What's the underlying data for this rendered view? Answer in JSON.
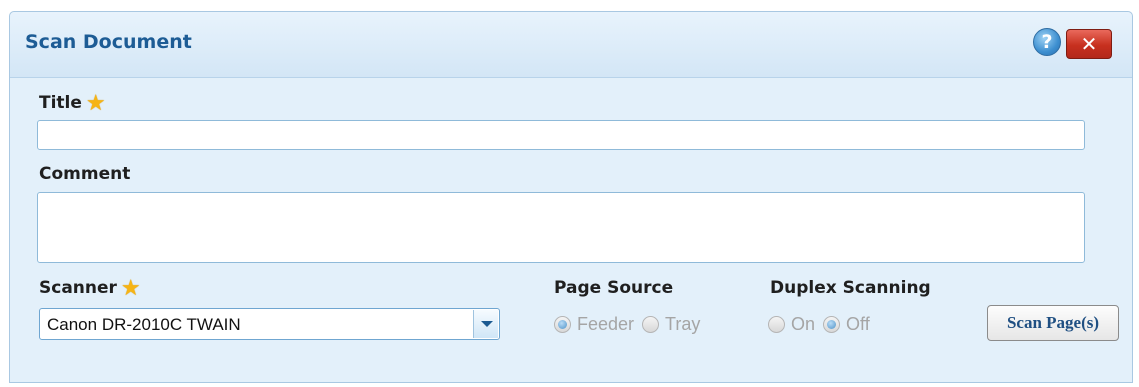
{
  "dialog": {
    "title": "Scan Document",
    "help_label": "?",
    "close_label": "✕"
  },
  "form": {
    "title_label": "Title",
    "title_value": "",
    "comment_label": "Comment",
    "comment_value": "",
    "scanner_label": "Scanner",
    "scanner_selected": "Canon DR-2010C TWAIN",
    "required_star": "★"
  },
  "page_source": {
    "label": "Page Source",
    "options": [
      {
        "label": "Feeder",
        "checked": true
      },
      {
        "label": "Tray",
        "checked": false
      }
    ]
  },
  "duplex": {
    "label": "Duplex Scanning",
    "options": [
      {
        "label": "On",
        "checked": false
      },
      {
        "label": "Off",
        "checked": true
      }
    ]
  },
  "actions": {
    "scan_label": "Scan Page(s)"
  },
  "colors": {
    "title_text": "#1d5c95",
    "dialog_bg": "#e3f0fa",
    "close_red": "#c7301f",
    "star": "#f6b415"
  }
}
